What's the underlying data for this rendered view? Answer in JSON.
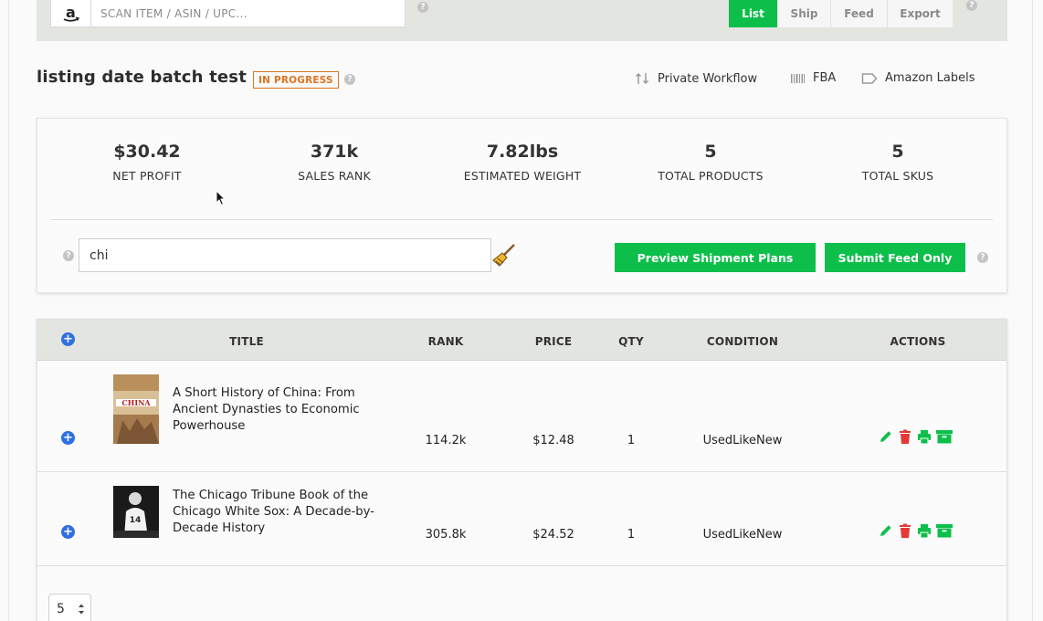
{
  "scan": {
    "placeholder": "SCAN ITEM / ASIN / UPC..."
  },
  "tabs": [
    {
      "label": "List",
      "active": true
    },
    {
      "label": "Ship",
      "active": false
    },
    {
      "label": "Feed",
      "active": false
    },
    {
      "label": "Export",
      "active": false
    }
  ],
  "help_glyph": "?",
  "batch": {
    "title": "listing date batch test",
    "status": "IN PROGRESS"
  },
  "header_links": {
    "workflow": "Private Workflow",
    "fba": "FBA",
    "labels": "Amazon Labels"
  },
  "stats": [
    {
      "value": "$30.42",
      "label": "NET PROFIT"
    },
    {
      "value": "371k",
      "label": "SALES RANK"
    },
    {
      "value": "7.82lbs",
      "label": "ESTIMATED WEIGHT"
    },
    {
      "value": "5",
      "label": "TOTAL PRODUCTS"
    },
    {
      "value": "5",
      "label": "TOTAL SKUS"
    }
  ],
  "filter": {
    "value": "chi"
  },
  "buttons": {
    "preview": "Preview Shipment Plans",
    "submit": "Submit Feed Only"
  },
  "table": {
    "add_glyph": "+",
    "headers": {
      "title": "TITLE",
      "rank": "RANK",
      "price": "PRICE",
      "qty": "QTY",
      "condition": "CONDITION",
      "actions": "ACTIONS"
    },
    "rows": [
      {
        "title": "A Short History of China: From Ancient Dynasties to Economic Powerhouse",
        "rank": "114.2k",
        "price": "$12.48",
        "qty": "1",
        "condition": "UsedLikeNew",
        "cover_text": "CHINA"
      },
      {
        "title": "The Chicago Tribune Book of the Chicago White Sox: A Decade-by-Decade History",
        "rank": "305.8k",
        "price": "$24.52",
        "qty": "1",
        "condition": "UsedLikeNew",
        "cover_text": "14"
      }
    ]
  },
  "pager": {
    "per_page": "5"
  },
  "colors": {
    "green": "#0dbf4a",
    "red": "#e53935",
    "blue": "#2f6fe4",
    "orange": "#e0731f"
  }
}
